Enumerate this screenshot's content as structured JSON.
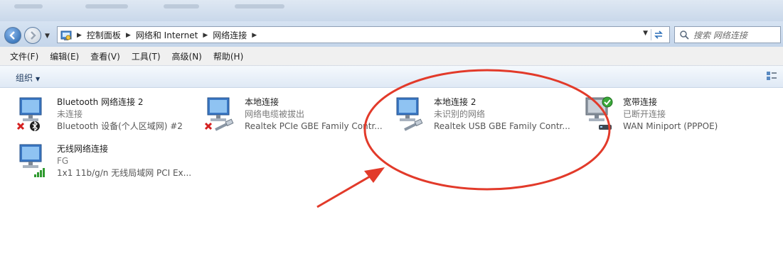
{
  "window": {
    "address": {
      "breadcrumbs": [
        "控制面板",
        "网络和 Internet",
        "网络连接"
      ]
    },
    "search": {
      "placeholder": "搜索 网络连接"
    }
  },
  "menu": [
    "文件(F)",
    "编辑(E)",
    "查看(V)",
    "工具(T)",
    "高级(N)",
    "帮助(H)"
  ],
  "toolbar": {
    "organize_label": "组织"
  },
  "connections": [
    {
      "name": "Bluetooth 网络连接 2",
      "status": "未连接",
      "device": "Bluetooth 设备(个人区域网) #2",
      "overlay": "disconnected-x-icon",
      "badge": "bluetooth-icon"
    },
    {
      "name": "本地连接",
      "status": "网络电缆被拔出",
      "device": "Realtek PCIe GBE Family Contr...",
      "overlay": "disconnected-x-icon",
      "badge": "ethernet-cable-icon"
    },
    {
      "name": "本地连接 2",
      "status": "未识别的网络",
      "device": "Realtek USB GBE Family Contr...",
      "overlay": "",
      "badge": "ethernet-cable-icon"
    },
    {
      "name": "宽带连接",
      "status": "已断开连接",
      "device": "WAN Miniport (PPPOE)",
      "overlay": "check-icon",
      "badge": "modem-icon"
    },
    {
      "name": "无线网络连接",
      "status": "FG",
      "device": "1x1 11b/g/n 无线局域网 PCI Ex...",
      "overlay": "",
      "badge": "wifi-signal-icon"
    }
  ],
  "annotation": {
    "color": "#e23a2a",
    "highlighted": "本地连接 2"
  }
}
